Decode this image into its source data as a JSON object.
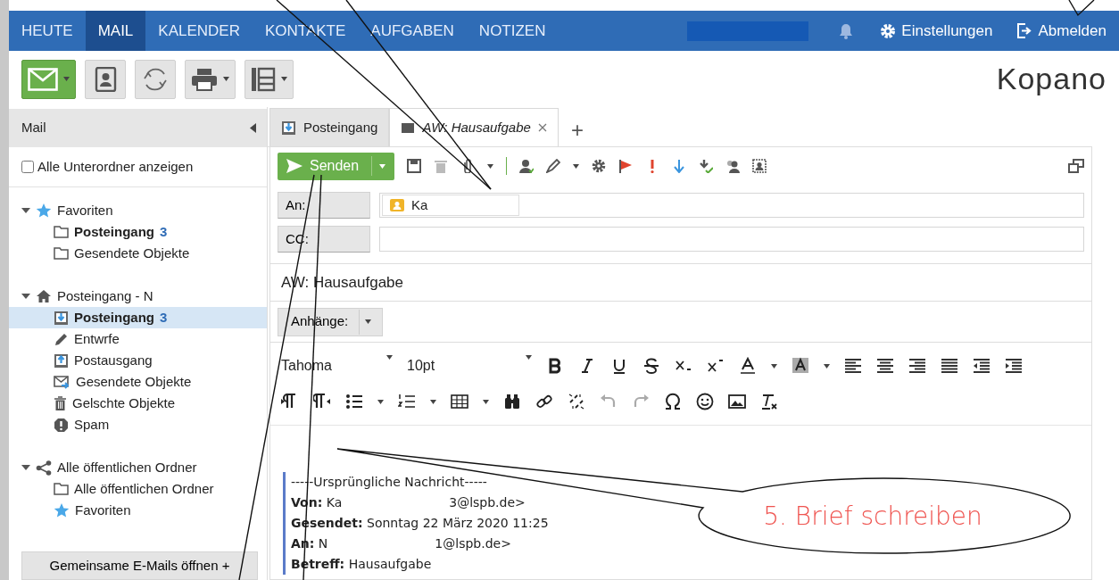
{
  "top_nav": {
    "tabs": [
      {
        "label": "HEUTE",
        "selected": false
      },
      {
        "label": "MAIL",
        "selected": true
      },
      {
        "label": "KALENDER",
        "selected": false
      },
      {
        "label": "KONTAKTE",
        "selected": false
      },
      {
        "label": "AUFGABEN",
        "selected": false
      },
      {
        "label": "NOTIZEN",
        "selected": false
      }
    ],
    "settings": "Einstellungen",
    "logout": "Abmelden"
  },
  "logo": "Kopano",
  "sidebar": {
    "title": "Mail",
    "show_subfolders": {
      "label": "Alle Unterordner anzeigen",
      "checked": false
    },
    "trees": [
      {
        "label": "Favoriten",
        "kind": "star",
        "expanded": true,
        "children": [
          {
            "label": "Posteingang",
            "count": "3",
            "kind": "folder",
            "selected": false
          },
          {
            "label": "Gesendete Objekte",
            "kind": "folder",
            "selected": false
          }
        ]
      },
      {
        "label": "Posteingang - N",
        "kind": "home",
        "expanded": true,
        "children": [
          {
            "label": "Posteingang",
            "count": "3",
            "kind": "inbox",
            "selected": true
          },
          {
            "label": "Entwrfe",
            "kind": "drafts",
            "selected": false
          },
          {
            "label": "Postausgang",
            "kind": "outbox",
            "selected": false
          },
          {
            "label": "Gesendete Objekte",
            "kind": "sent",
            "selected": false
          },
          {
            "label": "Gelschte Objekte",
            "kind": "trash",
            "selected": false
          },
          {
            "label": "Spam",
            "kind": "spam",
            "selected": false
          }
        ]
      },
      {
        "label": "Alle öffentlichen Ordner",
        "kind": "share",
        "expanded": true,
        "children": [
          {
            "label": "Alle öffentlichen Ordner",
            "kind": "folder",
            "selected": false
          },
          {
            "label": "Favoriten",
            "kind": "star",
            "selected": false
          }
        ]
      }
    ],
    "shared_button": "Gemeinsame E-Mails öffnen +"
  },
  "tabs": [
    {
      "label": "Posteingang",
      "selected": false
    },
    {
      "label": "AW: Hausaufgabe",
      "selected": true
    }
  ],
  "add_tab": "+",
  "compose": {
    "send": "Senden",
    "to_label": "An:",
    "to_chip": "Ka",
    "cc_label": "CC:",
    "subject": "AW: Hausaufgabe",
    "attachments": "Anhänge:",
    "font": "Tahoma",
    "size": "10pt",
    "quote_header": "-----Ursprüngliche Nachricht-----",
    "quote": [
      {
        "label": "Von:",
        "parts": [
          "Ka",
          "3@lspb.de>"
        ]
      },
      {
        "label": "Gesendet:",
        "parts": [
          "Sonntag 22 März 2020 11:25"
        ]
      },
      {
        "label": "An:",
        "parts": [
          "N",
          "1@lspb.de>"
        ]
      },
      {
        "label": "Betreff:",
        "parts": [
          "Hausaufgabe"
        ]
      }
    ]
  },
  "annotation": {
    "text": "5. Brief schreiben"
  }
}
